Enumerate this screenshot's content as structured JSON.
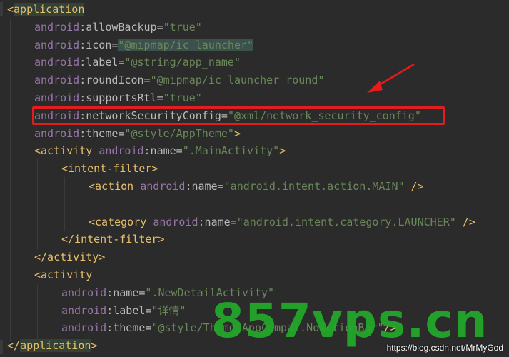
{
  "editor": {
    "lines": [
      {
        "segments": [
          {
            "cls": "tag",
            "text": "<"
          },
          {
            "cls": "tag tag-hl",
            "text": "application"
          }
        ]
      },
      {
        "segments": [
          {
            "cls": "ns",
            "text": "android"
          },
          {
            "cls": "attr-name",
            "text": ":allowBackup="
          },
          {
            "cls": "str",
            "text": "\"true\""
          }
        ]
      },
      {
        "segments": [
          {
            "cls": "ns",
            "text": "android"
          },
          {
            "cls": "attr-name",
            "text": ":icon="
          },
          {
            "cls": "str hl-bg",
            "text": "\"@mipmap/ic_launcher\""
          }
        ]
      },
      {
        "segments": [
          {
            "cls": "ns",
            "text": "android"
          },
          {
            "cls": "attr-name",
            "text": ":label="
          },
          {
            "cls": "str",
            "text": "\"@string/app_name\""
          }
        ]
      },
      {
        "segments": [
          {
            "cls": "ns",
            "text": "android"
          },
          {
            "cls": "attr-name",
            "text": ":roundIcon="
          },
          {
            "cls": "str",
            "text": "\"@mipmap/ic_launcher_round\""
          }
        ]
      },
      {
        "segments": [
          {
            "cls": "ns",
            "text": "android"
          },
          {
            "cls": "attr-name",
            "text": ":supportsRtl="
          },
          {
            "cls": "str",
            "text": "\"true\""
          }
        ]
      },
      {
        "segments": [
          {
            "cls": "ns",
            "text": "android"
          },
          {
            "cls": "attr-name",
            "text": ":networkSecurityConfig="
          },
          {
            "cls": "str",
            "text": "\"@xml/network_security_config\""
          }
        ]
      },
      {
        "segments": [
          {
            "cls": "ns",
            "text": "android"
          },
          {
            "cls": "attr-name",
            "text": ":theme="
          },
          {
            "cls": "str",
            "text": "\"@style/AppTheme\""
          },
          {
            "cls": "tag",
            "text": ">"
          }
        ]
      },
      {
        "segments": [
          {
            "cls": "tag",
            "text": "<activity "
          },
          {
            "cls": "ns",
            "text": "android"
          },
          {
            "cls": "attr-name",
            "text": ":name="
          },
          {
            "cls": "str",
            "text": "\".MainActivity\""
          },
          {
            "cls": "tag",
            "text": ">"
          }
        ]
      },
      {
        "segments": [
          {
            "cls": "tag",
            "text": "<intent-filter>"
          }
        ]
      },
      {
        "segments": [
          {
            "cls": "tag",
            "text": "<action "
          },
          {
            "cls": "ns",
            "text": "android"
          },
          {
            "cls": "attr-name",
            "text": ":name="
          },
          {
            "cls": "str",
            "text": "\"android.intent.action.MAIN\""
          },
          {
            "cls": "tag",
            "text": " />"
          }
        ]
      },
      {
        "segments": []
      },
      {
        "segments": [
          {
            "cls": "tag",
            "text": "<category "
          },
          {
            "cls": "ns",
            "text": "android"
          },
          {
            "cls": "attr-name",
            "text": ":name="
          },
          {
            "cls": "str",
            "text": "\"android.intent.category.LAUNCHER\""
          },
          {
            "cls": "tag",
            "text": " />"
          }
        ]
      },
      {
        "segments": [
          {
            "cls": "tag",
            "text": "</intent-filter>"
          }
        ]
      },
      {
        "segments": [
          {
            "cls": "tag",
            "text": "</activity>"
          }
        ]
      },
      {
        "segments": [
          {
            "cls": "tag",
            "text": "<activity"
          }
        ]
      },
      {
        "segments": [
          {
            "cls": "ns",
            "text": "android"
          },
          {
            "cls": "attr-name",
            "text": ":name="
          },
          {
            "cls": "str",
            "text": "\".NewDetailActivity\""
          }
        ]
      },
      {
        "segments": [
          {
            "cls": "ns",
            "text": "android"
          },
          {
            "cls": "attr-name",
            "text": ":label="
          },
          {
            "cls": "str",
            "text": "\"详情\""
          }
        ]
      },
      {
        "segments": [
          {
            "cls": "ns",
            "text": "android"
          },
          {
            "cls": "attr-name",
            "text": ":theme="
          },
          {
            "cls": "str",
            "text": "\"@style/Theme.AppCompat.NoActionBar\""
          },
          {
            "cls": "tag",
            "text": "/>"
          }
        ]
      },
      {
        "segments": [
          {
            "cls": "tag",
            "text": "</"
          },
          {
            "cls": "tag tag-hl",
            "text": "application"
          },
          {
            "cls": "tag",
            "text": ">"
          }
        ]
      }
    ]
  },
  "annotation": {
    "highlight_color": "#e11d1d",
    "arrow_color": "#e11d1d"
  },
  "watermark": {
    "big_text": "857vps.cn",
    "small_text": "https://blog.csdn.net/MrMyGod"
  },
  "colors": {
    "background": "#2b2b2b",
    "tag": "#e8bf6a",
    "namespace": "#9876aa",
    "attribute": "#bababa",
    "string": "#6a8759",
    "watermark": "#22aa2a"
  }
}
